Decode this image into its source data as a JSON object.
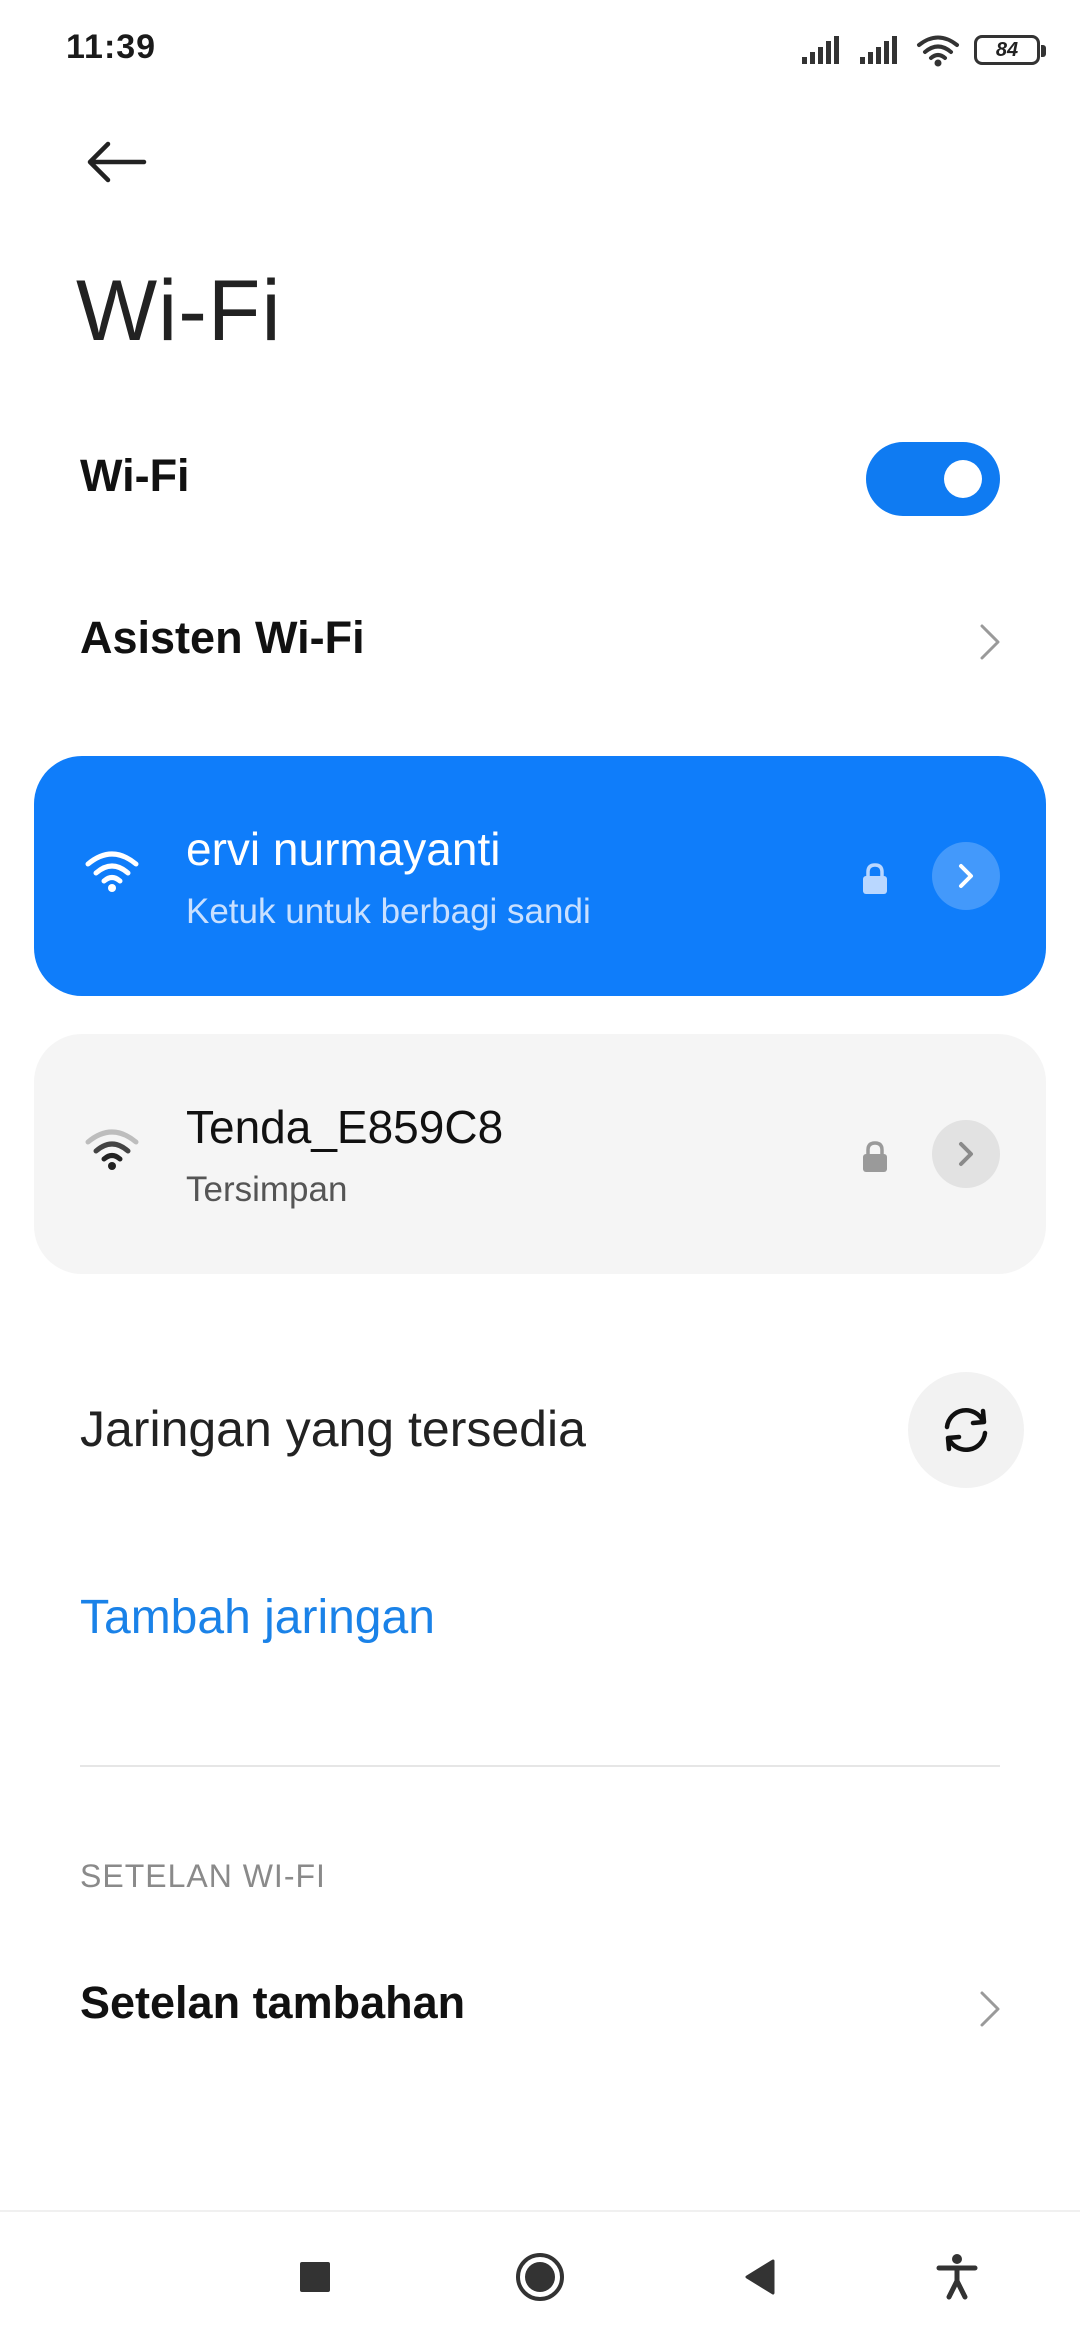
{
  "status_bar": {
    "time": "11:39",
    "battery": "84",
    "icons": [
      "signal-icon",
      "signal-icon",
      "wifi-icon",
      "battery-icon"
    ]
  },
  "header": {
    "back_icon": "arrow-left-icon",
    "title": "Wi-Fi"
  },
  "wifi_toggle": {
    "label": "Wi-Fi",
    "state": "on",
    "accent_color": "#0f7bf2"
  },
  "wifi_assistant": {
    "label": "Asisten Wi-Fi"
  },
  "networks": [
    {
      "name": "ervi nurmayanti",
      "subtitle": "Ketuk untuk berbagi sandi",
      "status": "connected",
      "secured": true,
      "color": "#0f7dfa"
    },
    {
      "name": "Tenda_E859C8",
      "subtitle": "Tersimpan",
      "status": "saved",
      "secured": true,
      "color": "#f5f5f5"
    }
  ],
  "available": {
    "label": "Jaringan yang tersedia",
    "refresh_icon": "refresh-icon"
  },
  "add_network": {
    "label": "Tambah jaringan",
    "color": "#1a82e8"
  },
  "settings_section": {
    "header": "SETELAN WI-FI",
    "items": [
      {
        "label": "Setelan tambahan"
      }
    ]
  },
  "nav_bar": {
    "buttons": [
      "recents-icon",
      "home-icon",
      "back-triangle-icon",
      "accessibility-icon"
    ]
  }
}
